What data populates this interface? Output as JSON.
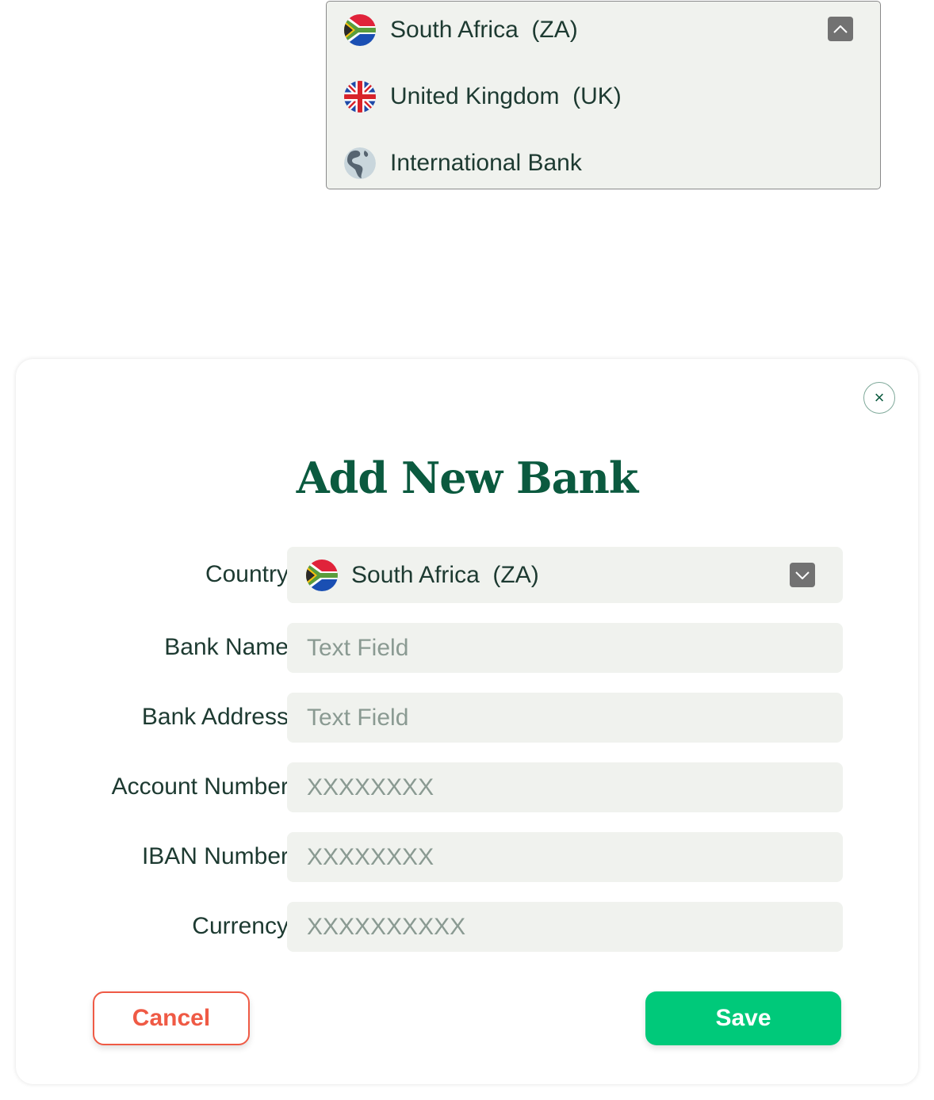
{
  "dropdown": {
    "options": [
      {
        "label": "South Africa  (ZA)",
        "icon": "south-africa-flag-icon"
      },
      {
        "label": "United Kingdom  (UK)",
        "icon": "uk-flag-icon"
      },
      {
        "label": "International Bank",
        "icon": "globe-icon"
      }
    ],
    "caret_icon": "chevron-up-icon"
  },
  "modal": {
    "title": "Add New Bank",
    "close_icon": "close-icon",
    "close_glyph": "×",
    "fields": {
      "country": {
        "label": "Country",
        "value": "South Africa  (ZA)"
      },
      "bank_name": {
        "label": "Bank Name",
        "placeholder": "Text Field"
      },
      "bank_address": {
        "label": "Bank Address",
        "placeholder": "Text Field"
      },
      "account_number": {
        "label": "Account Number",
        "placeholder": "XXXXXXXX"
      },
      "iban_number": {
        "label": "IBAN Number",
        "placeholder": "XXXXXXXX"
      },
      "currency": {
        "label": "Currency",
        "placeholder": "XXXXXXXXXX"
      }
    },
    "cancel_label": "Cancel",
    "save_label": "Save"
  },
  "colors": {
    "brand": "#0b5a3f",
    "save": "#00c97a",
    "cancel": "#ef5a45",
    "field_bg": "#f0f2ee"
  }
}
